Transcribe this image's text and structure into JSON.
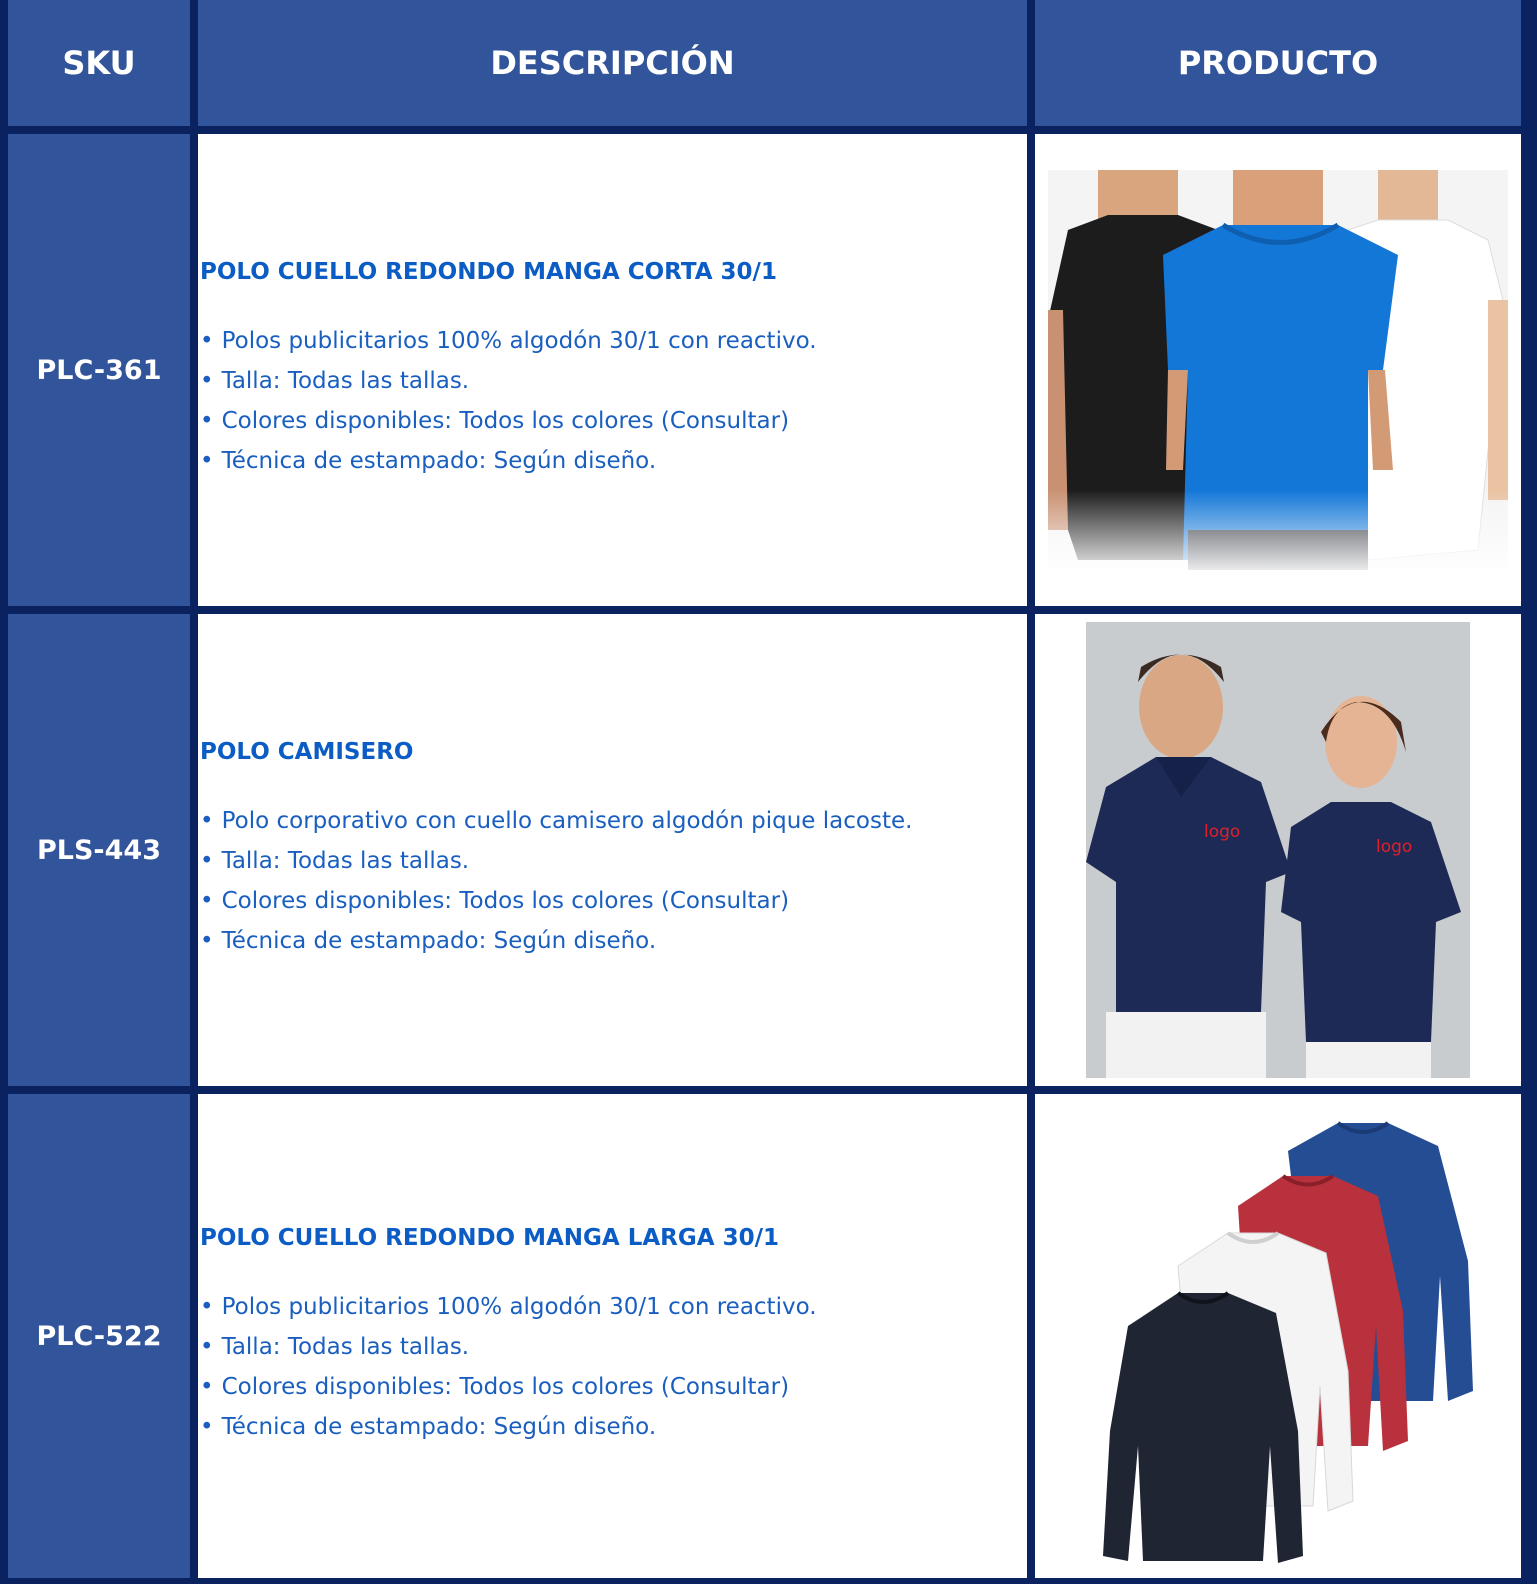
{
  "header": {
    "sku": "SKU",
    "description": "DESCRIPCIÓN",
    "product": "PRODUCTO"
  },
  "rows": [
    {
      "sku": "PLC-361",
      "title": "POLO CUELLO REDONDO MANGA CORTA 30/1",
      "bullets": [
        "Polos publicitarios 100% algodón 30/1 con reactivo.",
        "Talla: Todas las tallas.",
        "Colores disponibles: Todos los colores (Consultar)",
        "Técnica de estampado: Según diseño."
      ],
      "image": "three-men-crew-neck-tshirts"
    },
    {
      "sku": "PLS-443",
      "title": "POLO CAMISERO",
      "bullets": [
        "Polo corporativo con cuello camisero algodón pique lacoste.",
        "Talla: Todas las tallas.",
        "Colores disponibles: Todos los colores (Consultar)",
        "Técnica de estampado: Según diseño."
      ],
      "image": "man-and-woman-navy-polo-shirts",
      "logo_text": "logo"
    },
    {
      "sku": "PLC-522",
      "title": "POLO CUELLO REDONDO MANGA LARGA 30/1",
      "bullets": [
        "Polos publicitarios 100% algodón 30/1 con reactivo.",
        "Talla: Todas las tallas.",
        "Colores disponibles: Todos los colores (Consultar)",
        "Técnica de estampado: Según diseño."
      ],
      "image": "stacked-long-sleeve-shirts"
    }
  ],
  "bullet_char": "•",
  "colors": {
    "header_bg": "#32549a",
    "border": "#0a2260",
    "text_blue": "#1a5fc0",
    "title_blue": "#0b5cc5",
    "logo_red": "#e0202a"
  }
}
